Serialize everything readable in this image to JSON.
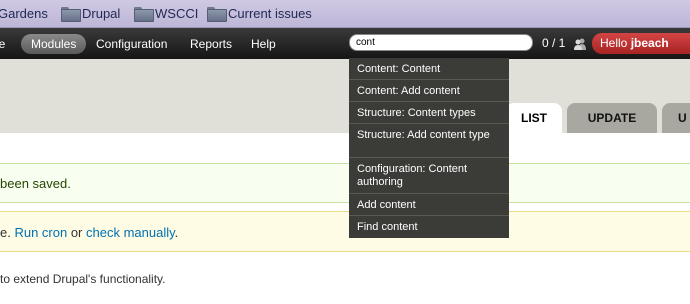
{
  "bookmarks": {
    "items": [
      {
        "label": "Gardens",
        "icon": "folder-icon"
      },
      {
        "label": "Drupal",
        "icon": "folder-icon"
      },
      {
        "label": "WSCCI",
        "icon": "folder-icon"
      },
      {
        "label": "Current issues",
        "icon": "folder-icon"
      }
    ]
  },
  "toolbar": {
    "items": [
      {
        "label": "le"
      },
      {
        "label": "Modules",
        "active": true
      },
      {
        "label": "Configuration"
      },
      {
        "label": "Reports"
      },
      {
        "label": "Help"
      }
    ],
    "search_value": "cont",
    "counter": "0 / 1",
    "hello_prefix": "Hello ",
    "hello_user": "jbeach",
    "accent_color": "#c03030"
  },
  "tabs": [
    {
      "label": "LIST",
      "active": true
    },
    {
      "label": "UPDATE"
    },
    {
      "label": "U"
    }
  ],
  "messages": {
    "status_text": "been saved.",
    "warning_prefix": "e. ",
    "warning_link1": "Run cron",
    "warning_mid": " or ",
    "warning_link2": "check manually",
    "warning_suffix": "."
  },
  "body_text": "to extend Drupal's functionality.",
  "autocomplete": {
    "items": [
      {
        "label": "Content: Content"
      },
      {
        "label": "Content: Add content"
      },
      {
        "label": "Structure: Content types"
      },
      {
        "label": "Structure: Add content type"
      },
      {
        "label": "Configuration: Content authoring"
      },
      {
        "label": "Add content"
      },
      {
        "label": "Find content"
      }
    ]
  }
}
